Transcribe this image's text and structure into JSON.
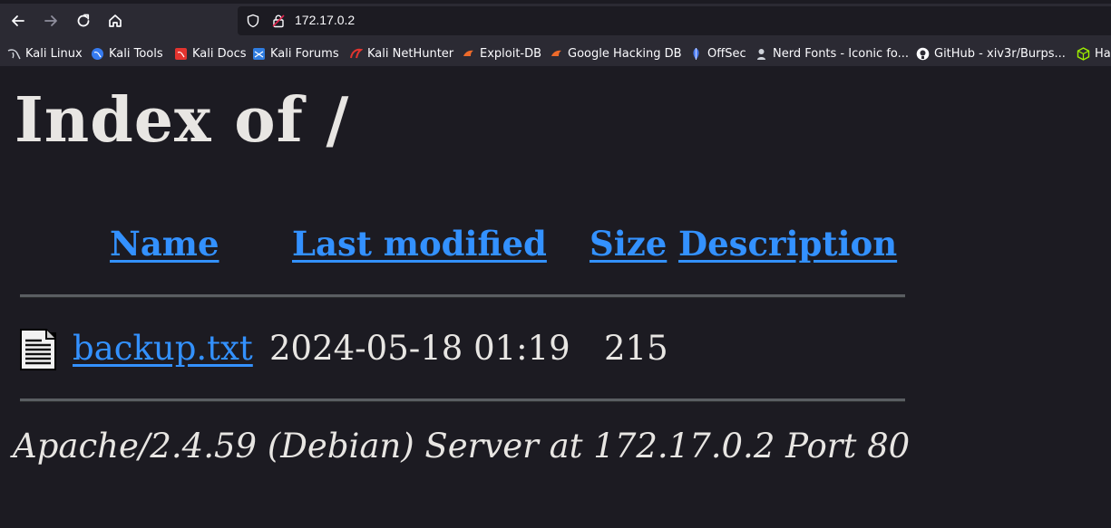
{
  "browser": {
    "url": "172.17.0.2",
    "bookmarks": [
      {
        "label": "Kali Linux",
        "icon": "kali-dragon-icon"
      },
      {
        "label": "Kali Tools",
        "icon": "kali-tools-icon"
      },
      {
        "label": "Kali Docs",
        "icon": "kali-docs-icon"
      },
      {
        "label": "Kali Forums",
        "icon": "kali-forums-icon"
      },
      {
        "label": "Kali NetHunter",
        "icon": "kali-nethunter-icon"
      },
      {
        "label": "Exploit-DB",
        "icon": "exploit-db-icon"
      },
      {
        "label": "Google Hacking DB",
        "icon": "ghdb-icon"
      },
      {
        "label": "OffSec",
        "icon": "offsec-icon"
      },
      {
        "label": "Nerd Fonts - Iconic fo...",
        "icon": "nerd-fonts-icon"
      },
      {
        "label": "GitHub - xiv3r/Burps...",
        "icon": "github-icon"
      },
      {
        "label": "Ha",
        "icon": "hack-the-box-icon"
      }
    ]
  },
  "page": {
    "title": "Index of /",
    "columns": [
      "Name",
      "Last modified",
      "Size",
      "Description"
    ],
    "rows": [
      {
        "name": "backup.txt",
        "modified": "2024-05-18 01:19",
        "size": "215",
        "description": "",
        "icon": "text-file-icon"
      }
    ],
    "footer": "Apache/2.4.59 (Debian) Server at 172.17.0.2 Port 80"
  },
  "colors": {
    "link": "#3391ff",
    "background": "#1c1b22",
    "text": "#e8e6e3",
    "toolbar": "#2b2a33"
  }
}
